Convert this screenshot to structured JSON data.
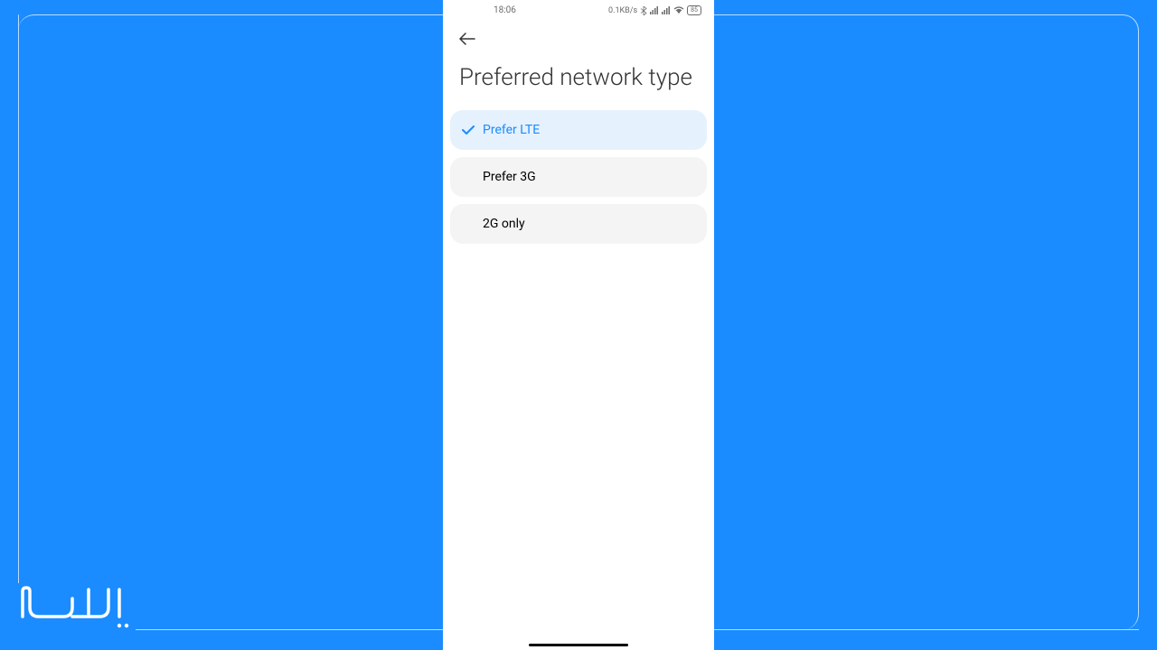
{
  "statusBar": {
    "time": "18:06",
    "dataRate": "0.1KB/s",
    "batteryLevel": "85"
  },
  "page": {
    "title": "Preferred network type"
  },
  "options": [
    {
      "label": "Prefer LTE",
      "selected": true
    },
    {
      "label": "Prefer 3G",
      "selected": false
    },
    {
      "label": "2G only",
      "selected": false
    }
  ],
  "logo": "ایـسل"
}
